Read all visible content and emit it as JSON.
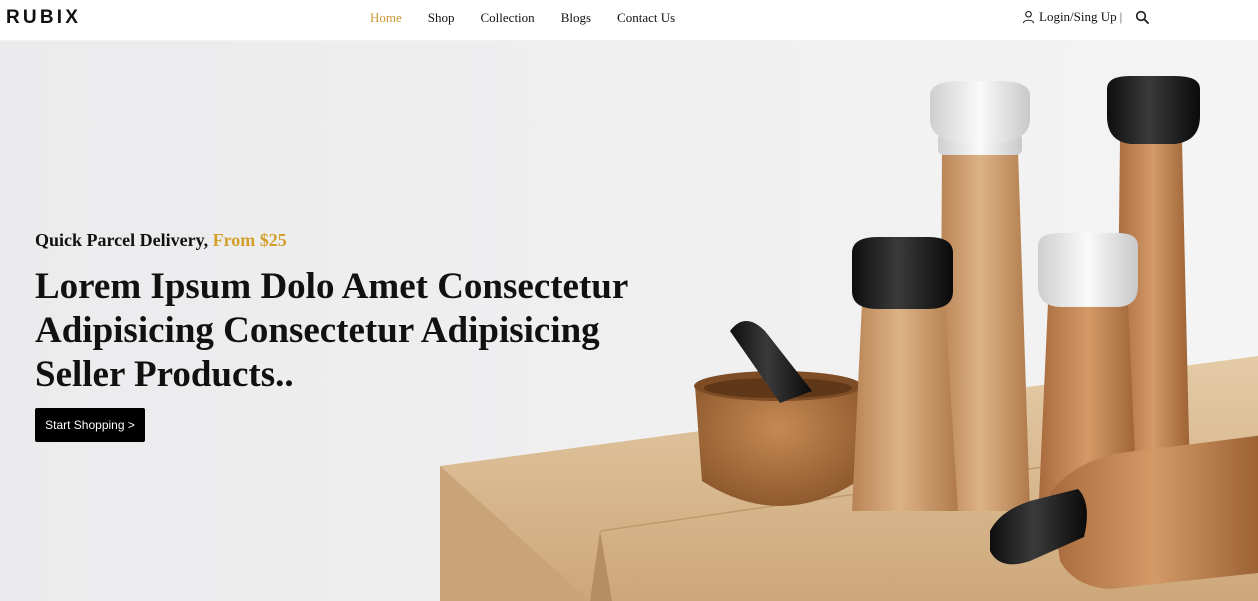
{
  "brand": {
    "logo_text": "RUBIX"
  },
  "nav": {
    "items": [
      {
        "label": "Home",
        "active": true
      },
      {
        "label": "Shop",
        "active": false
      },
      {
        "label": "Collection",
        "active": false
      },
      {
        "label": "Blogs",
        "active": false
      },
      {
        "label": "Contact Us",
        "active": false
      }
    ],
    "login_label": "Login/Sing Up",
    "separator": "|"
  },
  "hero": {
    "subtitle_prefix": "Quick Parcel Delivery,",
    "subtitle_price": "From $25",
    "headline": "Lorem Ipsum Dolo Amet Consectetur Adipisicing Consectetur Adipisicing Seller Products..",
    "cta_label": "Start Shopping >"
  },
  "icons": {
    "user": "user-icon",
    "search": "search-icon"
  },
  "colors": {
    "accent": "#cc9933",
    "price": "#d4a02c",
    "cta_bg": "#000000",
    "text": "#111111"
  }
}
